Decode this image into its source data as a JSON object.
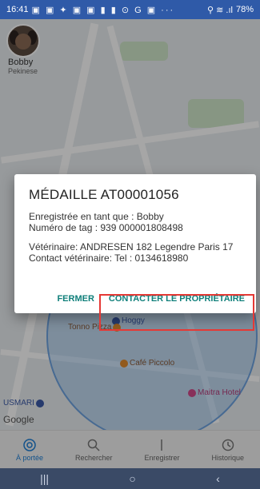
{
  "statusbar": {
    "time": "16:41",
    "left_icons": "▣ ▣ ✦ ▣ ▣ ▮ ▮ ⊙ G ▣ ···",
    "right_icons": "⚲ ≋ .ıl",
    "battery": "78%"
  },
  "map": {
    "pois": [
      {
        "label": "Café Piccolo"
      },
      {
        "label": "Maitra Hotel"
      },
      {
        "label": "Hoggy"
      },
      {
        "label": "Tonno Pizza"
      },
      {
        "label": "USMARI"
      }
    ],
    "google": "Google"
  },
  "profile": {
    "name": "Bobby",
    "subtitle": "Pekinese"
  },
  "dialog": {
    "title": "MÉDAILLE AT00001056",
    "line1": "Enregistrée en tant que : Bobby",
    "line2": "Numéro de tag : 939 000001808498",
    "line3": "Vétérinaire: ANDRESEN  182 Legendre Paris 17",
    "line4": "Contact vétérinaire: Tel : 0134618980",
    "btn_close": "FERMER",
    "btn_contact": "CONTACTER LE PROPRIÉTAIRE"
  },
  "bottomnav": {
    "items": [
      {
        "label": "À portée",
        "icon": "radar-icon"
      },
      {
        "label": "Rechercher",
        "icon": "search-icon"
      },
      {
        "label": "Enregistrer",
        "icon": "register-icon"
      },
      {
        "label": "Historique",
        "icon": "history-icon"
      }
    ],
    "active_color": "#1e7fd6"
  },
  "sysnav": {
    "recent": "|||",
    "home": "○",
    "back": "‹"
  }
}
